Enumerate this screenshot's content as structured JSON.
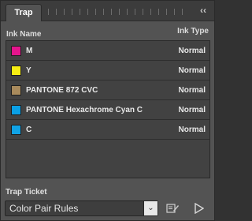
{
  "panel": {
    "tab_label": "Trap",
    "collapse_glyph": "‹‹"
  },
  "headers": {
    "name": "Ink Name",
    "type": "Ink Type"
  },
  "inks": [
    {
      "name": "M",
      "type": "Normal",
      "color": "#e4158c"
    },
    {
      "name": "Y",
      "type": "Normal",
      "color": "#f7ee13"
    },
    {
      "name": "PANTONE 872 CVC",
      "type": "Normal",
      "color": "#a88a5c"
    },
    {
      "name": "PANTONE Hexachrome Cyan C",
      "type": "Normal",
      "color": "#0aa0e6"
    },
    {
      "name": "C",
      "type": "Normal",
      "color": "#11a3e6"
    }
  ],
  "ticket": {
    "label": "Trap Ticket",
    "value": "Color Pair Rules",
    "arrow": "⌄"
  },
  "icons": {
    "edit": "edit-ticket-icon",
    "apply": "play-icon",
    "collapse": "collapse-panel-icon"
  }
}
